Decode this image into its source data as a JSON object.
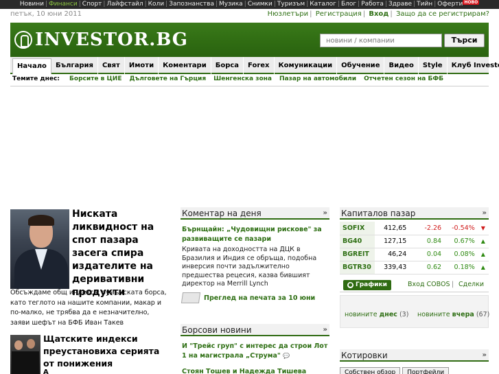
{
  "topbar": {
    "links": [
      "Новини",
      "Финанси",
      "Спорт",
      "Лайфстайл",
      "Коли",
      "Запознанства",
      "Музика",
      "Снимки",
      "Туризъм",
      "Каталог",
      "Блог",
      "Работа",
      "Здраве",
      "Тийн",
      "Оферти"
    ],
    "active": "Финанси",
    "badge": "НОВО"
  },
  "date": "петък, 10 юни 2011",
  "user_links": {
    "newsletters": "Нюзлетъри",
    "register": "Регистрация",
    "login": "Вход",
    "why": "Защо да се регистрирам?"
  },
  "brand": {
    "name": "INVESTOR.BG",
    "color": "#2f6b12"
  },
  "search": {
    "placeholder": "новини / компании",
    "button": "Търси"
  },
  "nav": [
    "Начало",
    "България",
    "Свят",
    "Имоти",
    "Коментари",
    "Борса",
    "Forex",
    "Комуникации",
    "Обучение",
    "Видео",
    "Style",
    "Клуб Investor.bg"
  ],
  "topics": {
    "label": "Темите днес:",
    "items": [
      "Борсите в ЦИЕ",
      "Дълговете на Гърция",
      "Шенгенска зона",
      "Пазар на автомобили",
      "Отчетен сезон на БФБ"
    ]
  },
  "lead": {
    "title": "Ниската ликвидност на спот пазара засега спира издателите на деривативни продукти",
    "text": "Обсъждаме общ индекс с румънската борса, като теглото на нашите компании, макар и по-малко, не трябва да е незначително, заяви шефът на БФБ Иван Такев"
  },
  "news2": {
    "title": "Щатските индекси преустановиха серията от понижения",
    "cont": "А"
  },
  "comment": {
    "header": "Коментар на деня",
    "title": "Бърнщайн: „Чудовищни рискове\" за развиващите се пазари",
    "text": "Кривата на доходността на ДЦК в Бразилия и Индия се обръща, подобна инверсия почти задължително предшества рецесия, казва бившият директор на Merrill Lynch",
    "press": "Преглед на печата за 10 юни"
  },
  "stock_news": {
    "header": "Борсови новини",
    "items": [
      "И \"Трейс груп\" с интерес да строи Лот 1 на магистрала „Струма\"",
      "Стоян Тошев и Надежда Тишева напускат"
    ]
  },
  "capital": {
    "header": "Капиталов пазар",
    "rows": [
      {
        "name": "SOFIX",
        "value": "412,65",
        "change": "-2.26",
        "pct": "-0.54%",
        "dir": "down"
      },
      {
        "name": "BG40",
        "value": "127,15",
        "change": "0.84",
        "pct": "0.67%",
        "dir": "up"
      },
      {
        "name": "BGREIT",
        "value": "46,24",
        "change": "0.04",
        "pct": "0.08%",
        "dir": "up"
      },
      {
        "name": "BGTR30",
        "value": "339,43",
        "change": "0.62",
        "pct": "0.18%",
        "dir": "up"
      }
    ],
    "graphs": "Графики",
    "cobos": "Вход COBOS",
    "deals": "Сделки"
  },
  "today": {
    "l_pre": "новините",
    "l_bold": "днес",
    "l_cnt": "(3)",
    "r_pre": "новините",
    "r_bold": "вчера",
    "r_cnt": "(67)"
  },
  "quotes": {
    "header": "Котировки",
    "tabs": [
      "Собствен обзор",
      "Портфейли"
    ]
  }
}
